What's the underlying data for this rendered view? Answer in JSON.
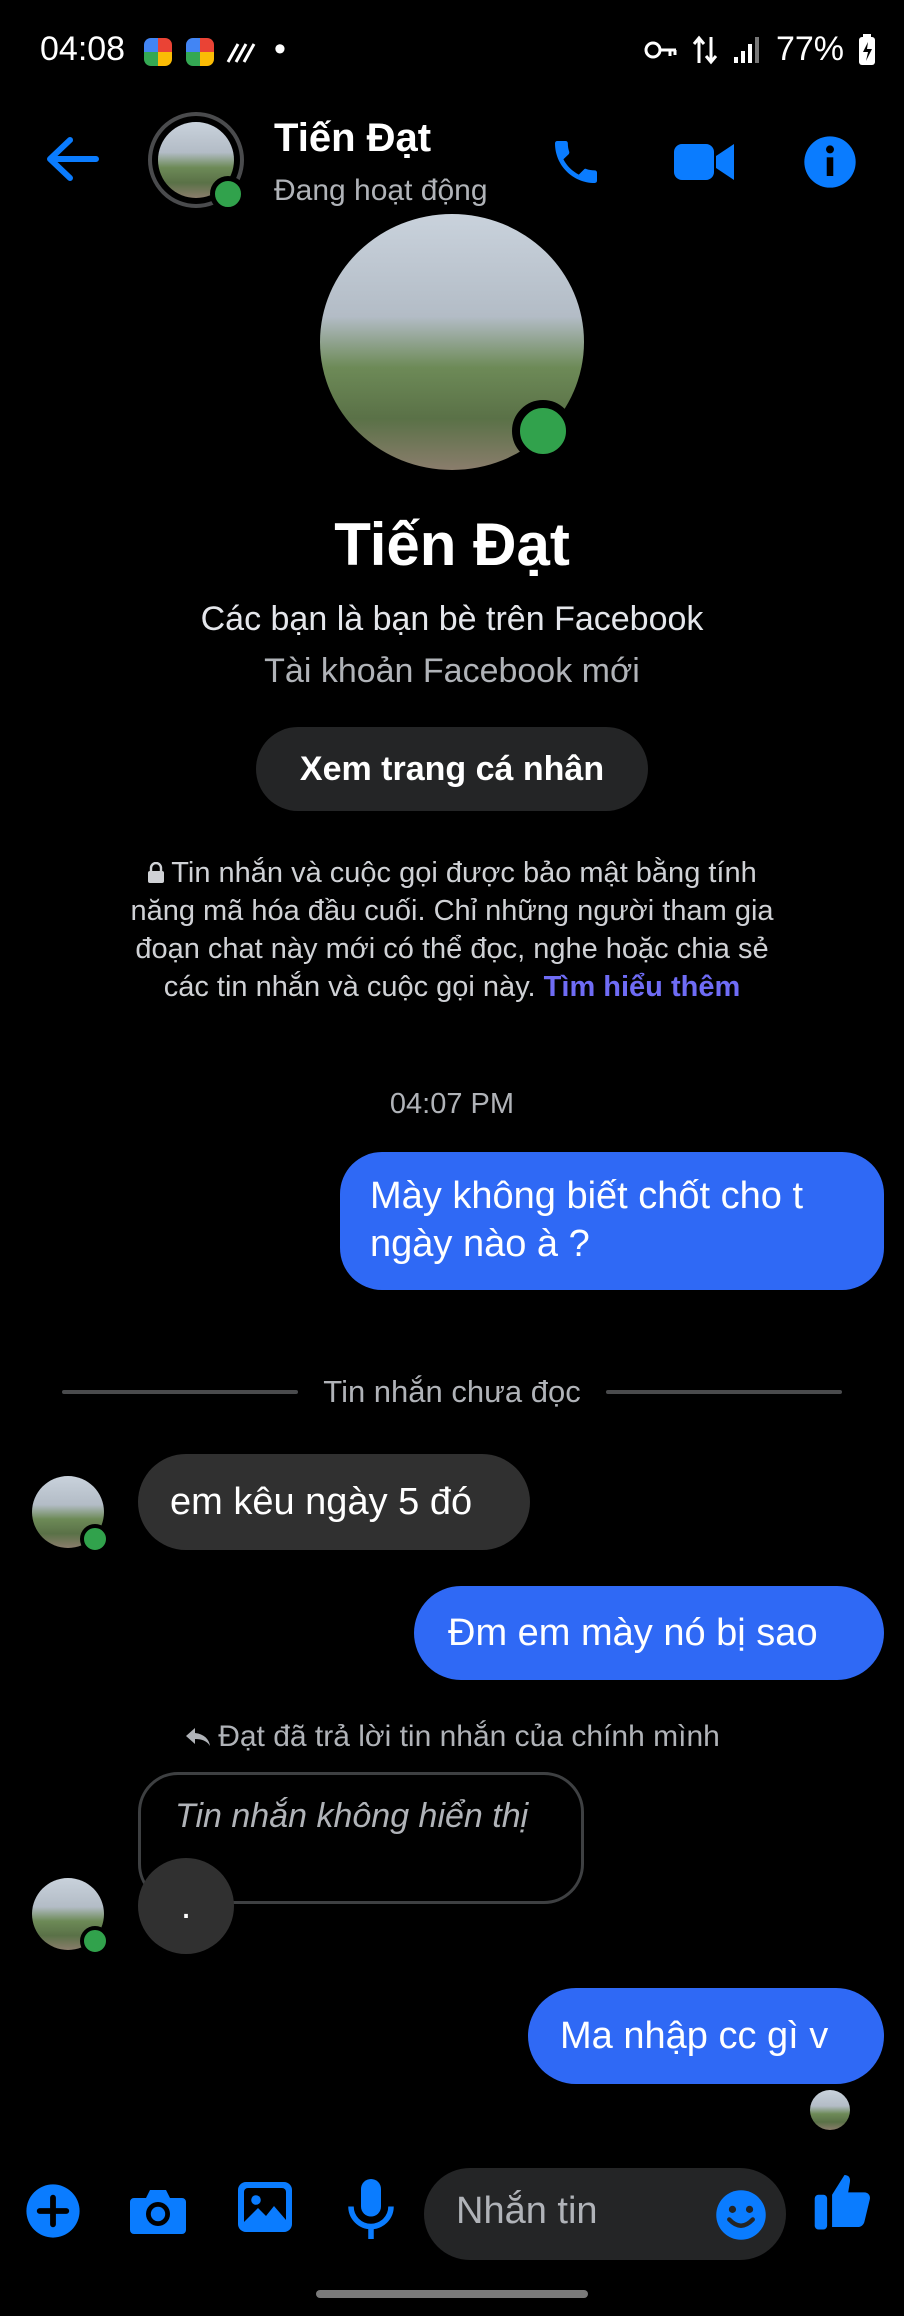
{
  "status_bar": {
    "time": "04:08",
    "dot": "•",
    "battery": "77%"
  },
  "header": {
    "name": "Tiến Đạt",
    "status": "Đang hoạt động"
  },
  "profile": {
    "name": "Tiến Đạt",
    "friends_line": "Các bạn là bạn bè trên Facebook",
    "new_account_line": "Tài khoản Facebook mới",
    "view_profile_button": "Xem trang cá nhân"
  },
  "encryption_notice": {
    "text": "Tin nhắn và cuộc gọi được bảo mật bằng tính năng mã hóa đầu cuối. Chỉ những người tham gia đoạn chat này mới có thể đọc, nghe hoặc chia sẻ các tin nhắn và cuộc gọi này.",
    "link": "Tìm hiểu thêm"
  },
  "timestamp": "04:07 PM",
  "messages": {
    "out_1_line1": "Mày không biết chốt cho t",
    "out_1_line2": "ngày nào à ?",
    "unread_divider": "Tin nhắn chưa đọc",
    "in_1": "em kêu ngày 5 đó",
    "out_2": "Đm em mày nó bị sao",
    "reply_note": "Đạt đã trả lời tin nhắn của chính mình",
    "hidden_message": "Tin nhắn không hiển thị",
    "in_2": ".",
    "out_3": "Ma nhập cc gì v"
  },
  "composer": {
    "placeholder": "Nhắn tin"
  },
  "colors": {
    "accent": "#0a7cff",
    "outgoing_bubble": "#2f69f5",
    "incoming_bubble": "#303030",
    "online": "#31a24c"
  }
}
